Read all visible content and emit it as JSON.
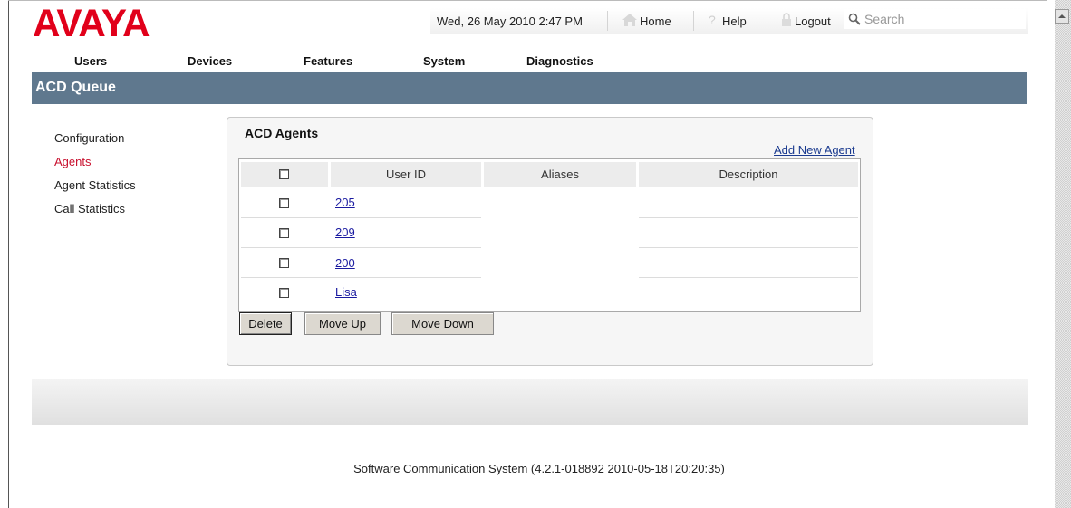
{
  "header": {
    "logo": "AVAYA",
    "datetime": "Wed, 26 May 2010 2:47 PM",
    "home": "Home",
    "help": "Help",
    "logout": "Logout",
    "search_placeholder": "Search"
  },
  "nav": {
    "items": [
      "Users",
      "Devices",
      "Features",
      "System",
      "Diagnostics"
    ]
  },
  "page_title": "ACD Queue",
  "sidebar": {
    "items": [
      "Configuration",
      "Agents",
      "Agent Statistics",
      "Call Statistics"
    ],
    "active": "Agents"
  },
  "panel": {
    "title": "ACD Agents",
    "add_link": "Add New Agent",
    "columns": [
      "User ID",
      "Aliases",
      "Description"
    ],
    "rows": [
      {
        "user_id": "205",
        "aliases": "",
        "description": ""
      },
      {
        "user_id": "209",
        "aliases": "",
        "description": ""
      },
      {
        "user_id": "200",
        "aliases": "",
        "description": ""
      },
      {
        "user_id": "Lisa",
        "aliases": "",
        "description": ""
      }
    ],
    "buttons": {
      "delete": "Delete",
      "move_up": "Move Up",
      "move_down": "Move Down"
    }
  },
  "footer": "Software Communication System (4.2.1-018892 2010-05-18T20:20:35)",
  "colors": {
    "brand_red": "#e1001a",
    "title_bar": "#5f788e",
    "active_link": "#c8102e",
    "link": "#1a1aa0"
  }
}
